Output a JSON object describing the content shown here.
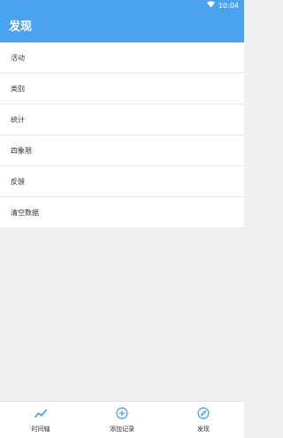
{
  "status_bar": {
    "time": "10:04",
    "wifi_icon": "wifi-icon"
  },
  "header": {
    "title": "发现"
  },
  "menu": {
    "items": [
      {
        "label": "活动"
      },
      {
        "label": "类别"
      },
      {
        "label": "统计"
      },
      {
        "label": "四象限"
      },
      {
        "label": "反馈"
      },
      {
        "label": "清空数据"
      }
    ]
  },
  "tabs": [
    {
      "label": "时间轴",
      "icon": "timeline-icon"
    },
    {
      "label": "添加记录",
      "icon": "add-circle-icon"
    },
    {
      "label": "发现",
      "icon": "compass-icon"
    }
  ],
  "colors": {
    "accent": "#4aa3ee",
    "background": "#f0f0f0"
  }
}
